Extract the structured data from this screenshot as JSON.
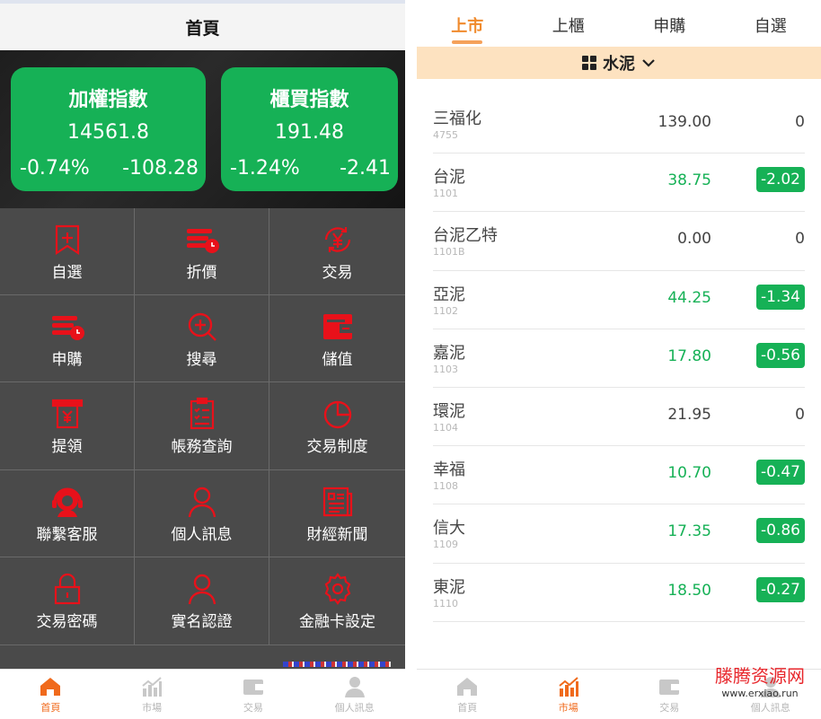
{
  "left": {
    "header_title": "首頁",
    "indices": [
      {
        "name": "加權指數",
        "value": "14561.8",
        "pct": "-0.74%",
        "change": "-108.28"
      },
      {
        "name": "櫃買指數",
        "value": "191.48",
        "pct": "-1.24%",
        "change": "-2.41"
      }
    ],
    "menu": [
      {
        "label": "自選",
        "icon": "bookmark-plus-icon"
      },
      {
        "label": "折價",
        "icon": "stack-clock-icon"
      },
      {
        "label": "交易",
        "icon": "yen-cycle-icon"
      },
      {
        "label": "申購",
        "icon": "stack-clock-icon"
      },
      {
        "label": "搜尋",
        "icon": "search-icon"
      },
      {
        "label": "儲值",
        "icon": "wallet-icon"
      },
      {
        "label": "提領",
        "icon": "atm-icon"
      },
      {
        "label": "帳務查詢",
        "icon": "document-check-icon"
      },
      {
        "label": "交易制度",
        "icon": "pie-chart-icon"
      },
      {
        "label": "聯繫客服",
        "icon": "support-icon"
      },
      {
        "label": "個人訊息",
        "icon": "user-icon"
      },
      {
        "label": "財經新聞",
        "icon": "newspaper-icon"
      },
      {
        "label": "交易密碼",
        "icon": "lock-icon"
      },
      {
        "label": "實名認證",
        "icon": "user-icon"
      },
      {
        "label": "金融卡設定",
        "icon": "gear-icon"
      }
    ],
    "tabbar": [
      {
        "label": "首頁",
        "icon": "home-icon",
        "active": true
      },
      {
        "label": "市場",
        "icon": "chart-icon",
        "active": false
      },
      {
        "label": "交易",
        "icon": "wallet-icon",
        "active": false
      },
      {
        "label": "個人訊息",
        "icon": "user-icon",
        "active": false
      }
    ]
  },
  "right": {
    "tabs": [
      {
        "label": "上市",
        "active": true
      },
      {
        "label": "上櫃",
        "active": false
      },
      {
        "label": "申購",
        "active": false
      },
      {
        "label": "自選",
        "active": false
      }
    ],
    "sector_label": "水泥",
    "stocks": [
      {
        "name": "三福化",
        "code": "4755",
        "price": "139.00",
        "change": "0",
        "down": false
      },
      {
        "name": "台泥",
        "code": "1101",
        "price": "38.75",
        "change": "-2.02",
        "down": true
      },
      {
        "name": "台泥乙特",
        "code": "1101B",
        "price": "0.00",
        "change": "0",
        "down": false
      },
      {
        "name": "亞泥",
        "code": "1102",
        "price": "44.25",
        "change": "-1.34",
        "down": true
      },
      {
        "name": "嘉泥",
        "code": "1103",
        "price": "17.80",
        "change": "-0.56",
        "down": true
      },
      {
        "name": "環泥",
        "code": "1104",
        "price": "21.95",
        "change": "0",
        "down": false
      },
      {
        "name": "幸福",
        "code": "1108",
        "price": "10.70",
        "change": "-0.47",
        "down": true
      },
      {
        "name": "信大",
        "code": "1109",
        "price": "17.35",
        "change": "-0.86",
        "down": true
      },
      {
        "name": "東泥",
        "code": "1110",
        "price": "18.50",
        "change": "-0.27",
        "down": true
      }
    ],
    "tabbar": [
      {
        "label": "首頁",
        "icon": "home-icon",
        "active": false
      },
      {
        "label": "市場",
        "icon": "chart-icon",
        "active": true
      },
      {
        "label": "交易",
        "icon": "wallet-icon",
        "active": false
      },
      {
        "label": "個人訊息",
        "icon": "user-icon",
        "active": false
      }
    ],
    "watermark_title": "滕腾资源网",
    "watermark_url": "www.erxiao.run"
  },
  "colors": {
    "green": "#16b156",
    "accent": "#f06a1c",
    "icon_red": "#e8111a"
  }
}
